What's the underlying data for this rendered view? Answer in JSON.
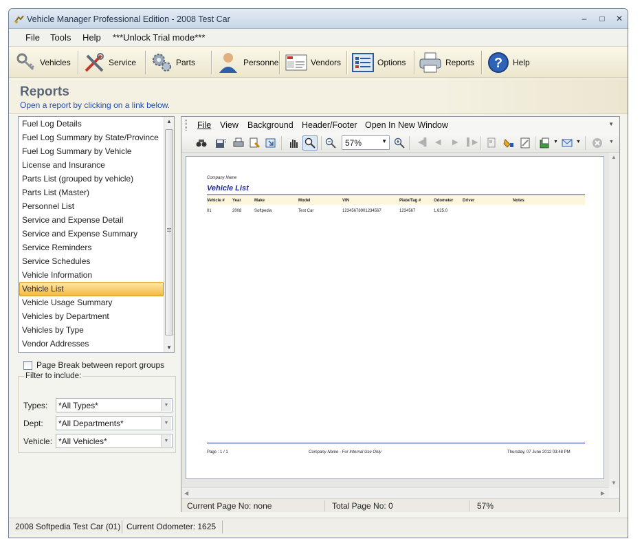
{
  "window": {
    "title": "Vehicle Manager Professional Edition - 2008 Test Car"
  },
  "menu": [
    "File",
    "Tools",
    "Help",
    "***Unlock Trial mode***"
  ],
  "toolbar": {
    "vehicles": "Vehicles",
    "service": "Service",
    "parts": "Parts",
    "personnel": "Personnel",
    "vendors": "Vendors",
    "options": "Options",
    "reports": "Reports",
    "help": "Help"
  },
  "reports_header": {
    "title": "Reports",
    "subtitle": "Open a report by clicking on a link below."
  },
  "report_list": {
    "items": [
      "Fuel Log Details",
      "Fuel Log Summary by State/Province",
      "Fuel Log Summary by Vehicle",
      "License and Insurance",
      "Parts List (grouped by vehicle)",
      "Parts List (Master)",
      "Personnel List",
      "Service and Expense Detail",
      "Service and Expense Summary",
      "Service Reminders",
      "Service Schedules",
      "Vehicle Information",
      "Vehicle List",
      "Vehicle Usage Summary",
      "Vehicles by Department",
      "Vehicles by Type",
      "Vendor Addresses"
    ],
    "selected": "Vehicle List"
  },
  "options": {
    "page_break_label": "Page Break between report groups",
    "page_break_checked": false
  },
  "filter": {
    "legend": "Filter to include:",
    "types_label": "Types:",
    "types_value": "*All Types*",
    "dept_label": "Dept:",
    "dept_value": "*All Departments*",
    "vehicle_label": "Vehicle:",
    "vehicle_value": "*All Vehicles*"
  },
  "preview": {
    "menu": [
      "File",
      "View",
      "Background",
      "Header/Footer",
      "Open In New Window"
    ],
    "zoom": "57%",
    "status": {
      "current_page": "Current Page No: none",
      "total_pages": "Total Page No: 0",
      "zoom": "57%"
    }
  },
  "report": {
    "company": "Company Name",
    "title": "Vehicle List",
    "columns": [
      "Vehicle #",
      "Year",
      "Make",
      "Model",
      "VIN",
      "Plate/Tag #",
      "Odometer",
      "Driver",
      "Notes"
    ],
    "rows": [
      [
        "01",
        "2008",
        "Softpedia",
        "Test Car",
        "12345678901234567",
        "1234567",
        "1,625.0",
        "",
        ""
      ]
    ],
    "footer_page": "Page : 1 / 1",
    "footer_center": "Company Name - For Internal Use Only",
    "footer_date": "Thursday, 07 June 2012 03:48 PM"
  },
  "statusbar": {
    "vehicle": "2008 Softpedia Test Car (01)",
    "odometer": "Current Odometer: 1625"
  },
  "colors": {
    "selection": "#f6b846",
    "link": "#1f4fb3",
    "report_title": "#1b2a9c",
    "report_header_bg": "#fdf6dd"
  }
}
